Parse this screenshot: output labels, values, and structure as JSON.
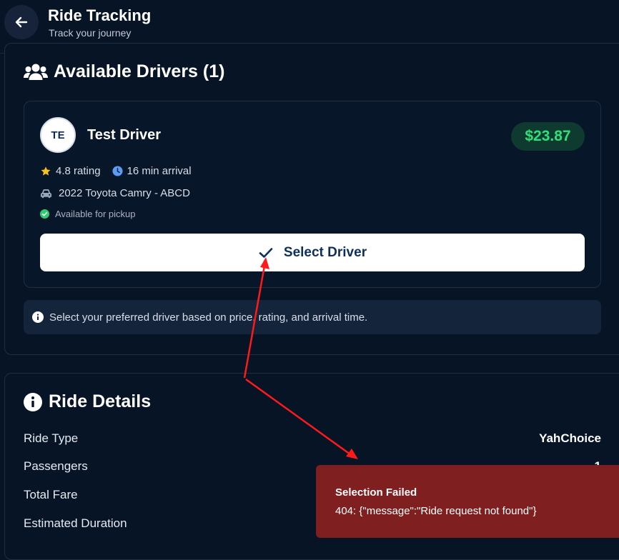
{
  "header": {
    "title": "Ride Tracking",
    "subtitle": "Track your journey",
    "back_icon": "arrow-left-icon"
  },
  "drivers_section": {
    "title": "Available Drivers (1)",
    "icon": "users-icon",
    "driver": {
      "initials": "TE",
      "name": "Test Driver",
      "price": "$23.87",
      "rating": "4.8 rating",
      "arrival": "16 min arrival",
      "vehicle": "2022 Toyota Camry - ABCD",
      "availability": "Available for pickup",
      "select_label": "Select Driver"
    },
    "info_text": "Select your preferred driver based on price, rating, and arrival time."
  },
  "ride_details": {
    "title": "Ride Details",
    "rows": [
      {
        "label": "Ride Type",
        "value": "YahChoice"
      },
      {
        "label": "Passengers",
        "value": "1"
      },
      {
        "label": "Total Fare",
        "value": ""
      },
      {
        "label": "Estimated Duration",
        "value": ""
      }
    ]
  },
  "toast": {
    "title": "Selection Failed",
    "message": "404: {\"message\":\"Ride request not found\"}"
  },
  "colors": {
    "background": "#061426",
    "price": "#2ee07a",
    "toast": "#7f1f1f",
    "annotation": "#ff1a1a"
  }
}
